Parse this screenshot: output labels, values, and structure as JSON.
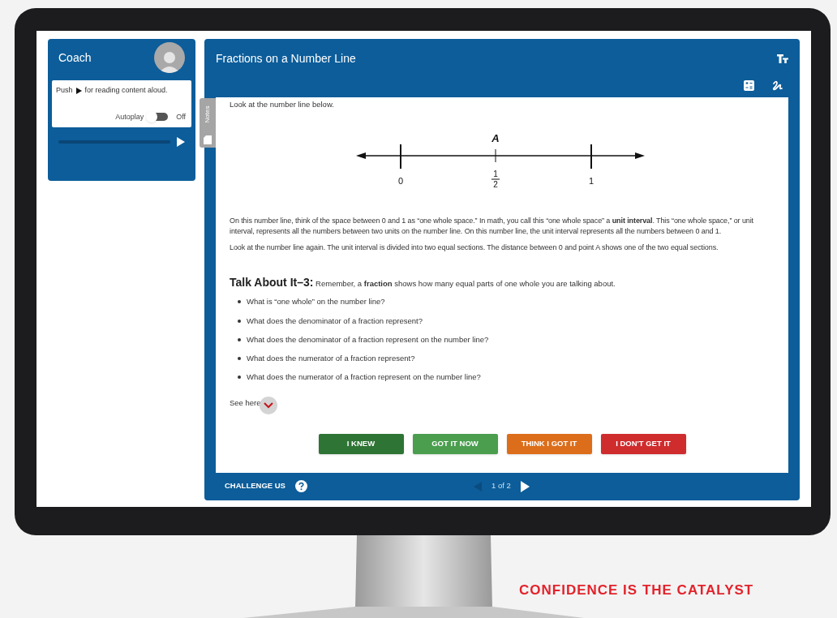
{
  "coach": {
    "title": "Coach",
    "hint_before": "Push",
    "hint_after": "for reading content aloud.",
    "autoplay": {
      "label": "Autoplay",
      "on": false,
      "state_text": "Off"
    }
  },
  "notes_tab": {
    "label": "Notes"
  },
  "lesson": {
    "title": "Fractions on a Number Line",
    "intro": "Look at the number line below.",
    "number_line": {
      "point_label": "A",
      "ticks": [
        {
          "kind": "whole",
          "label": "0"
        },
        {
          "kind": "fraction",
          "numerator": "1",
          "denominator": "2"
        },
        {
          "kind": "whole",
          "label": "1"
        }
      ]
    },
    "paragraphs": [
      "On this number line, think of the space between 0 and 1 as “one whole space.” In math, you call this “one whole space” a **unit interval**. This “one whole space,” or unit interval, represents all the numbers between two units on the number line. On this number line, the unit interval represents all the numbers between 0 and 1.",
      "Look at the number line again. The unit interval is divided into two equal sections. The distance between 0 and point A shows one of the two equal sections."
    ],
    "talk_heading": "Talk About It–3:",
    "talk_text": "Remember, a **fraction** shows how many equal parts of one whole you are talking about.",
    "questions": [
      "What is “one whole” on the number line?",
      "What does the denominator of a fraction represent?",
      "What does the denominator of a fraction represent on the number line?",
      "What does the numerator of a fraction represent?",
      "What does the numerator of a fraction represent on the number line?"
    ],
    "see_here": "See here",
    "buttons": [
      {
        "label": "I KNEW",
        "color": "#2e7434"
      },
      {
        "label": "GOT IT NOW",
        "color": "#4a9e4e"
      },
      {
        "label": "THINK I GOT IT",
        "color": "#dc6e1b"
      },
      {
        "label": "I DON'T GET IT",
        "color": "#cf2c2e"
      }
    ]
  },
  "footer": {
    "challenge": "CHALLENGE US",
    "page": "1 of 2",
    "prev_disabled": true,
    "next_disabled": false
  },
  "tagline": "CONFIDENCE IS THE CATALYST"
}
